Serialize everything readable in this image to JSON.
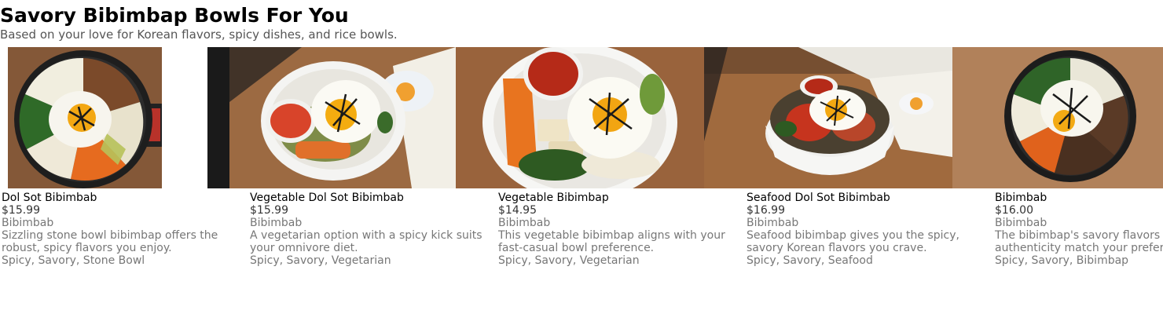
{
  "header": {
    "title": "Savory Bibimbap Bowls For You",
    "subtitle": "Based on your love for Korean flavors, spicy dishes, and rice bowls."
  },
  "products": [
    {
      "name": "Dol Sot Bibimbab",
      "price": "$15.99",
      "category": "Bibimbab",
      "description": "Sizzling stone bowl bibimbap offers the robust, spicy flavors you enjoy.",
      "tags": "Spicy, Savory, Stone Bowl"
    },
    {
      "name": "Vegetable Dol Sot Bibimbab",
      "price": "$15.99",
      "category": "Bibimbab",
      "description": "A vegetarian option with a spicy kick suits your omnivore diet.",
      "tags": "Spicy, Savory, Vegetarian"
    },
    {
      "name": "Vegetable Bibimbap",
      "price": "$14.95",
      "category": "Bibimbab",
      "description": "This vegetable bibimbap aligns with your fast-casual bowl preference.",
      "tags": "Spicy, Savory, Vegetarian"
    },
    {
      "name": "Seafood Dol Sot Bibimbab",
      "price": "$16.99",
      "category": "Bibimbab",
      "description": "Seafood bibimbap gives you the spicy, savory Korean flavors you crave.",
      "tags": "Spicy, Savory, Seafood"
    },
    {
      "name": "Bibimbab",
      "price": "$16.00",
      "category": "Bibimbab",
      "description": "The bibimbap's savory flavors and authenticity match your preferences.",
      "tags": "Spicy, Savory, Bibimbap"
    }
  ]
}
